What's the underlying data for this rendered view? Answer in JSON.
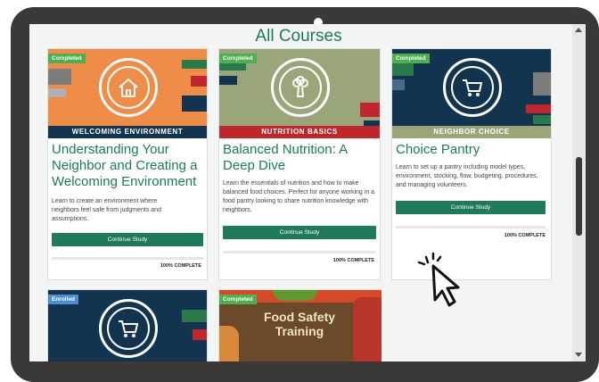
{
  "page": {
    "heading": "All Courses"
  },
  "courses": [
    {
      "badge": "Completed",
      "banner": "WELCOMING ENVIRONMENT",
      "title": "Understanding Your Neighbor and Creating a Welcoming Environment",
      "description": "Learn to create an environment where neighbors feel safe from judgments and assumptions.",
      "button": "Continue Study",
      "progress": 100,
      "progress_label": "100% COMPLETE",
      "colors": {
        "banner": "#ef8c47",
        "stripe": "#13344f"
      }
    },
    {
      "badge": "Completed",
      "banner": "NUTRITION BASICS",
      "title": "Balanced Nutrition: A Deep Dive",
      "description": "Learn the essentials of nutrition and how to make balanced food choices. Perfect for anyone working in a food pantry looking to share nutrition knowledge with neighbors.",
      "button": "Continue Study",
      "progress": 100,
      "progress_label": "100% COMPLETE",
      "colors": {
        "banner": "#9aa57a",
        "stripe": "#c0272d"
      }
    },
    {
      "badge": "Completed",
      "banner": "NEIGHBOR CHOICE",
      "title": "Choice Pantry",
      "description": "Learn to set up a pantry including model types, environment, stocking, flow, budgeting, procedures, and managing volunteers.",
      "button": "Continue Study",
      "progress": 100,
      "progress_label": "100% COMPLETE",
      "colors": {
        "banner": "#13344f",
        "stripe": "#9aa57a"
      }
    },
    {
      "badge": "Enrolled",
      "colors": {
        "banner": "#13344f"
      }
    },
    {
      "badge": "Completed",
      "image_text": "Food Safety Training"
    }
  ],
  "icons": [
    "house-icon",
    "broccoli-icon",
    "shopping-cart-icon",
    "cursor-icon"
  ]
}
